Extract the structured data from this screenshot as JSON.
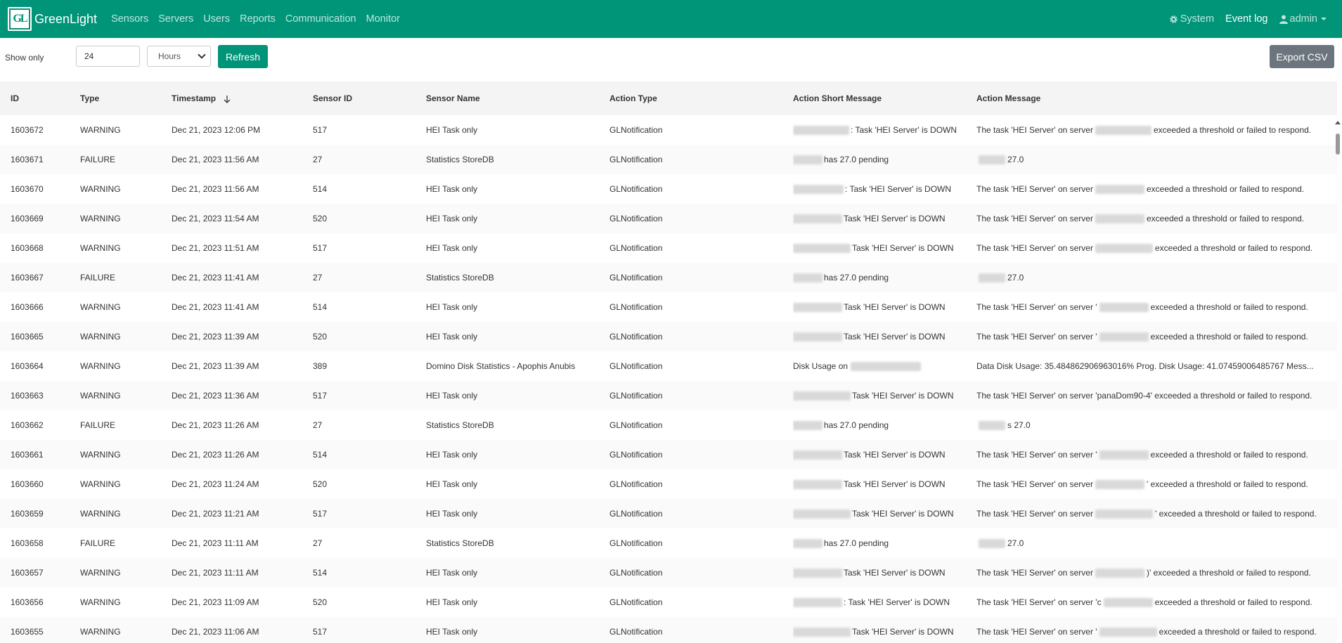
{
  "nav": {
    "logo_text": "GL",
    "brand": "GreenLight",
    "links": [
      "Sensors",
      "Servers",
      "Users",
      "Reports",
      "Communication",
      "Monitor"
    ],
    "system": "System",
    "event_log": "Event log",
    "user": "admin"
  },
  "toolbar": {
    "show_only_label": "Show only",
    "amount": "24",
    "unit": "Hours",
    "refresh": "Refresh",
    "export": "Export CSV"
  },
  "table": {
    "headers": [
      "ID",
      "Type",
      "Timestamp",
      "Sensor ID",
      "Sensor Name",
      "Action Type",
      "Action Short Message",
      "Action Message"
    ],
    "rows": [
      {
        "id": "1603672",
        "type": "WARNING",
        "ts": "Dec 21, 2023 12:06 PM",
        "sid": "517",
        "name": "HEI Task only",
        "action": "GLNotification",
        "short": ": Task 'HEI Server' is DOWN",
        "msg_a": "The task 'HEI Server' on server",
        "msg_b": "exceeded a threshold or failed to respond."
      },
      {
        "id": "1603671",
        "type": "FAILURE",
        "ts": "Dec 21, 2023 11:56 AM",
        "sid": "27",
        "name": "Statistics StoreDB",
        "action": "GLNotification",
        "short": "has 27.0 pending",
        "msg_a": "",
        "msg_b": "27.0"
      },
      {
        "id": "1603670",
        "type": "WARNING",
        "ts": "Dec 21, 2023 11:56 AM",
        "sid": "514",
        "name": "HEI Task only",
        "action": "GLNotification",
        "short": ": Task 'HEI Server' is DOWN",
        "msg_a": "The task 'HEI Server' on server",
        "msg_b": "exceeded a threshold or failed to respond."
      },
      {
        "id": "1603669",
        "type": "WARNING",
        "ts": "Dec 21, 2023 11:54 AM",
        "sid": "520",
        "name": "HEI Task only",
        "action": "GLNotification",
        "short": "Task 'HEI Server' is DOWN",
        "msg_a": "The task 'HEI Server' on server",
        "msg_b": "exceeded a threshold or failed to respond."
      },
      {
        "id": "1603668",
        "type": "WARNING",
        "ts": "Dec 21, 2023 11:51 AM",
        "sid": "517",
        "name": "HEI Task only",
        "action": "GLNotification",
        "short": "Task 'HEI Server' is DOWN",
        "msg_a": "The task 'HEI Server' on server",
        "msg_b": "exceeded a threshold or failed to respond."
      },
      {
        "id": "1603667",
        "type": "FAILURE",
        "ts": "Dec 21, 2023 11:41 AM",
        "sid": "27",
        "name": "Statistics StoreDB",
        "action": "GLNotification",
        "short": "has 27.0 pending",
        "msg_a": "",
        "msg_b": "27.0"
      },
      {
        "id": "1603666",
        "type": "WARNING",
        "ts": "Dec 21, 2023 11:41 AM",
        "sid": "514",
        "name": "HEI Task only",
        "action": "GLNotification",
        "short": "Task 'HEI Server' is DOWN",
        "msg_a": "The task 'HEI Server' on server '",
        "msg_b": "exceeded a threshold or failed to respond."
      },
      {
        "id": "1603665",
        "type": "WARNING",
        "ts": "Dec 21, 2023 11:39 AM",
        "sid": "520",
        "name": "HEI Task only",
        "action": "GLNotification",
        "short": "Task 'HEI Server' is DOWN",
        "msg_a": "The task 'HEI Server' on server '",
        "msg_b": "exceeded a threshold or failed to respond."
      },
      {
        "id": "1603664",
        "type": "WARNING",
        "ts": "Dec 21, 2023 11:39 AM",
        "sid": "389",
        "name": "Domino Disk Statistics - Apophis Anubis",
        "action": "GLNotification",
        "short": "Disk Usage on",
        "msg_a": "Data Disk Usage: 35.484862906963016% Prog. Disk Usage: 41.07459006485767 Mess...",
        "msg_b": ""
      },
      {
        "id": "1603663",
        "type": "WARNING",
        "ts": "Dec 21, 2023 11:36 AM",
        "sid": "517",
        "name": "HEI Task only",
        "action": "GLNotification",
        "short": "Task 'HEI Server' is DOWN",
        "msg_a": "The task 'HEI Server' on server 'panaDom90-4' exceeded a threshold or failed to respond.",
        "msg_b": ""
      },
      {
        "id": "1603662",
        "type": "FAILURE",
        "ts": "Dec 21, 2023 11:26 AM",
        "sid": "27",
        "name": "Statistics StoreDB",
        "action": "GLNotification",
        "short": "has 27.0 pending",
        "msg_a": "",
        "msg_b": "s 27.0"
      },
      {
        "id": "1603661",
        "type": "WARNING",
        "ts": "Dec 21, 2023 11:26 AM",
        "sid": "514",
        "name": "HEI Task only",
        "action": "GLNotification",
        "short": "Task 'HEI Server' is DOWN",
        "msg_a": "The task 'HEI Server' on server '",
        "msg_b": "exceeded a threshold or failed to respond."
      },
      {
        "id": "1603660",
        "type": "WARNING",
        "ts": "Dec 21, 2023 11:24 AM",
        "sid": "520",
        "name": "HEI Task only",
        "action": "GLNotification",
        "short": "Task 'HEI Server' is DOWN",
        "msg_a": "The task 'HEI Server' on server",
        "msg_b": "' exceeded a threshold or failed to respond."
      },
      {
        "id": "1603659",
        "type": "WARNING",
        "ts": "Dec 21, 2023 11:21 AM",
        "sid": "517",
        "name": "HEI Task only",
        "action": "GLNotification",
        "short": "Task 'HEI Server' is DOWN",
        "msg_a": "The task 'HEI Server' on server",
        "msg_b": "' exceeded a threshold or failed to respond."
      },
      {
        "id": "1603658",
        "type": "FAILURE",
        "ts": "Dec 21, 2023 11:11 AM",
        "sid": "27",
        "name": "Statistics StoreDB",
        "action": "GLNotification",
        "short": "has 27.0 pending",
        "msg_a": "",
        "msg_b": "27.0"
      },
      {
        "id": "1603657",
        "type": "WARNING",
        "ts": "Dec 21, 2023 11:11 AM",
        "sid": "514",
        "name": "HEI Task only",
        "action": "GLNotification",
        "short": "Task 'HEI Server' is DOWN",
        "msg_a": "The task 'HEI Server' on server",
        "msg_b": ")' exceeded a threshold or failed to respond."
      },
      {
        "id": "1603656",
        "type": "WARNING",
        "ts": "Dec 21, 2023 11:09 AM",
        "sid": "520",
        "name": "HEI Task only",
        "action": "GLNotification",
        "short": ": Task 'HEI Server' is DOWN",
        "msg_a": "The task 'HEI Server' on server 'c",
        "msg_b": "exceeded a threshold or failed to respond."
      },
      {
        "id": "1603655",
        "type": "WARNING",
        "ts": "Dec 21, 2023 11:06 AM",
        "sid": "517",
        "name": "HEI Task only",
        "action": "GLNotification",
        "short": "Task 'HEI Server' is DOWN",
        "msg_a": "The task 'HEI Server' on server '",
        "msg_b": "exceeded a threshold or failed to respond."
      }
    ]
  }
}
